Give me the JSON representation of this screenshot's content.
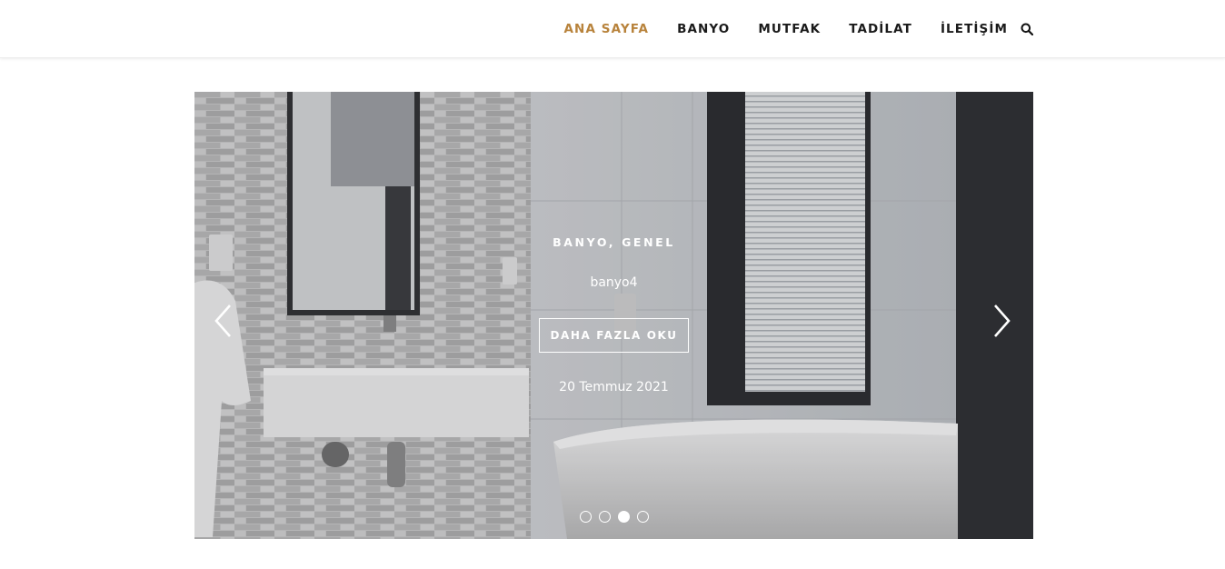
{
  "nav": {
    "items": [
      {
        "label": "ANA SAYFA",
        "active": true
      },
      {
        "label": "BANYO",
        "active": false
      },
      {
        "label": "MUTFAK",
        "active": false
      },
      {
        "label": "TADİLAT",
        "active": false
      },
      {
        "label": "İLETİŞİM",
        "active": false
      }
    ],
    "search_icon": "search-icon",
    "active_color": "#b8833c"
  },
  "slider": {
    "category": "BANYO, GENEL",
    "title": "banyo4",
    "button_label": "DAHA FAZLA OKU",
    "date": "20 Temmuz 2021",
    "prev_icon": "chevron-left-icon",
    "next_icon": "chevron-right-icon",
    "slide_count": 4,
    "active_slide": 3
  }
}
